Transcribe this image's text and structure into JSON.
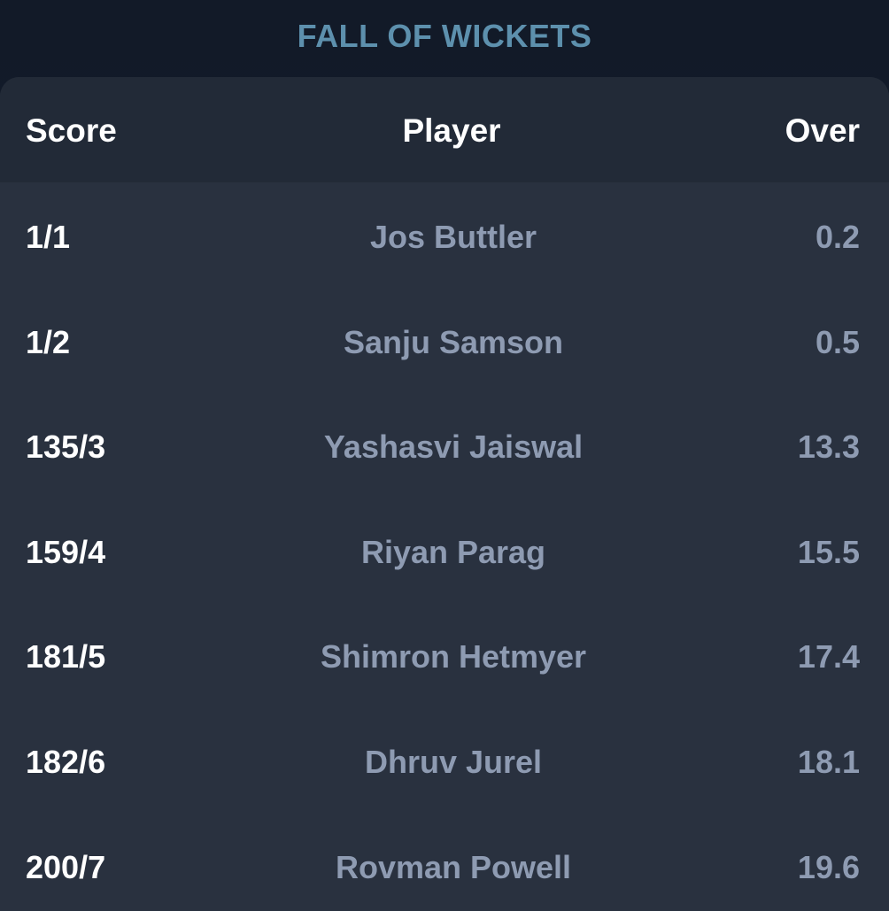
{
  "section": {
    "title": "FALL OF WICKETS"
  },
  "table": {
    "headers": {
      "score": "Score",
      "player": "Player",
      "over": "Over"
    },
    "rows": [
      {
        "score": "1/1",
        "player": "Jos Buttler",
        "over": "0.2"
      },
      {
        "score": "1/2",
        "player": "Sanju Samson",
        "over": "0.5"
      },
      {
        "score": "135/3",
        "player": "Yashasvi Jaiswal",
        "over": "13.3"
      },
      {
        "score": "159/4",
        "player": "Riyan Parag",
        "over": "15.5"
      },
      {
        "score": "181/5",
        "player": "Shimron Hetmyer",
        "over": "17.4"
      },
      {
        "score": "182/6",
        "player": "Dhruv Jurel",
        "over": "18.1"
      },
      {
        "score": "200/7",
        "player": "Rovman Powell",
        "over": "19.6"
      }
    ]
  },
  "colors": {
    "title": "#5d90ad",
    "card": "#29313f",
    "header": "#222a37",
    "primary_text": "#ffffff",
    "secondary_text": "#8e9bb2"
  }
}
